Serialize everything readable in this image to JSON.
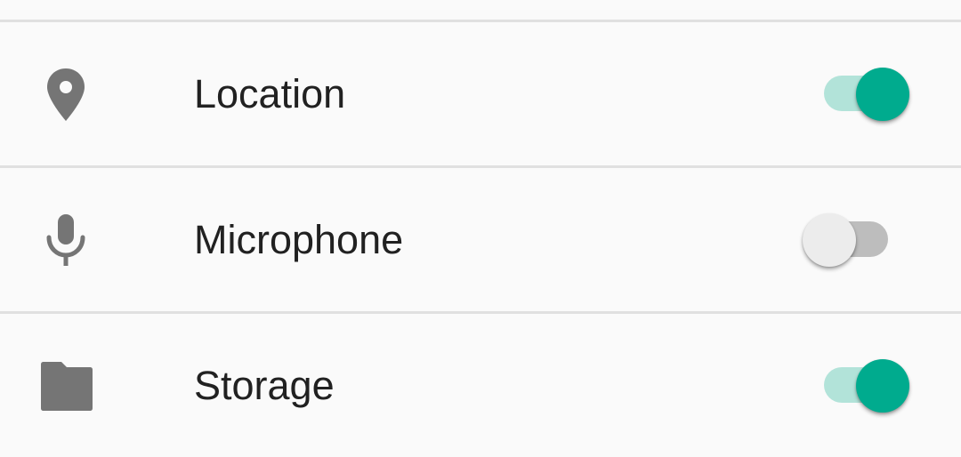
{
  "permissions": [
    {
      "label": "Location",
      "icon": "location-pin-icon",
      "enabled": true
    },
    {
      "label": "Microphone",
      "icon": "microphone-icon",
      "enabled": false
    },
    {
      "label": "Storage",
      "icon": "folder-icon",
      "enabled": true
    }
  ],
  "colors": {
    "background": "#fafafa",
    "divider": "#e0e0e0",
    "icon": "#757575",
    "text": "#212121",
    "switch_on_thumb": "#00ab8e",
    "switch_on_track": "#b2e3d9",
    "switch_off_thumb": "#ececec",
    "switch_off_track": "#bdbdbd"
  }
}
